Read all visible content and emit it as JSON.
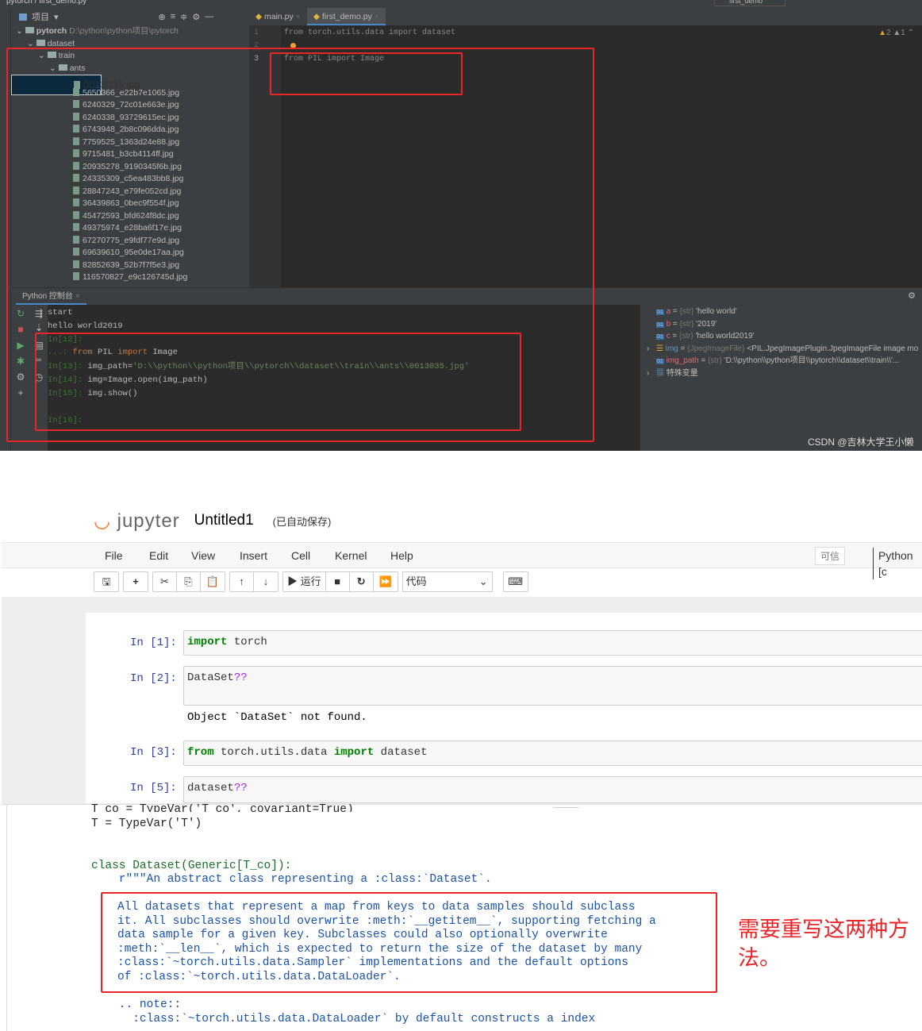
{
  "ide": {
    "breadcrumb": "pytorch  /  first_demo.py",
    "project_label": "项目",
    "project_root": {
      "name": "pytorch",
      "path": "D:\\python\\python项目\\pytorch"
    },
    "folders": [
      "dataset",
      "train",
      "ants"
    ],
    "files": [
      "0013035.jpg",
      "5650366_e22b7e1065.jpg",
      "6240329_72c01e663e.jpg",
      "6240338_93729615ec.jpg",
      "6743948_2b8c096dda.jpg",
      "7759525_1363d24e88.jpg",
      "9715481_b3cb4114ff.jpg",
      "20935278_9190345f6b.jpg",
      "24335309_c5ea483bb8.jpg",
      "28847243_e79fe052cd.jpg",
      "36439863_0bec9f554f.jpg",
      "45472593_bfd624f8dc.jpg",
      "49375974_e28ba6f17e.jpg",
      "67270775_e9fdf77e9d.jpg",
      "69639610_95e0de17aa.jpg",
      "82852639_52b7f7f5e3.jpg",
      "116570827_e9c126745d.jpg"
    ],
    "tabs": [
      "main.py",
      "first_demo.py"
    ],
    "run_config": "first_demo",
    "editor": {
      "lines": [
        {
          "n": "1",
          "text": "from torch.utils.data import dataset"
        },
        {
          "n": "2",
          "text": ""
        },
        {
          "n": "3",
          "text": "from PIL import Image"
        }
      ],
      "warnings": "2",
      "weak_warnings": "1"
    },
    "console": {
      "tab": "Python 控制台",
      "lines": [
        {
          "prompt": "",
          "text": "start"
        },
        {
          "prompt": "",
          "text": "hello world2019"
        },
        {
          "prompt": "In[12]:",
          "text": ""
        },
        {
          "prompt": "   ...:",
          "kw1": "from",
          "mid": " PIL ",
          "kw2": "import",
          "rest": " Image"
        },
        {
          "prompt": "In[13]:",
          "code": "img_path=",
          "str": "'D:\\\\python\\\\python项目\\\\pytorch\\\\dataset\\\\train\\\\ants\\\\0013035.jpg'"
        },
        {
          "prompt": "In[14]:",
          "text": "img=Image.open(img_path)"
        },
        {
          "prompt": "In[15]:",
          "text": "img.show()"
        },
        {
          "prompt": "In[16]:",
          "text": ""
        }
      ]
    },
    "variables": [
      {
        "name": "a",
        "type": "{str}",
        "value": "'hello world'"
      },
      {
        "name": "b",
        "type": "{str}",
        "value": "'2019'"
      },
      {
        "name": "c",
        "type": "{str}",
        "value": "'hello world2019'"
      },
      {
        "name": "img",
        "type": "{JpegImageFile}",
        "value": "<PIL.JpegImagePlugin.JpegImageFile image mo"
      },
      {
        "name": "img_path",
        "type": "{str}",
        "value": "'D:\\\\python\\\\python项目\\\\pytorch\\\\dataset\\\\train\\\\'..."
      },
      {
        "name": "特殊变量",
        "type": "",
        "value": ""
      }
    ],
    "watermark": "CSDN @吉林大学王小懒"
  },
  "jupyter": {
    "logo": "jupyter",
    "notebook_name": "Untitled1",
    "save_status": "(已自动保存)",
    "menu": [
      "File",
      "Edit",
      "View",
      "Insert",
      "Cell",
      "Kernel",
      "Help"
    ],
    "trusted": "可信",
    "kernel": "Python [c",
    "run_label": "运行",
    "cell_type": "代码",
    "cells": [
      {
        "prompt": "In  [1]:",
        "kw": "import",
        "rest": " torch"
      },
      {
        "prompt": "In  [2]:",
        "code": "DataSet",
        "q": "??",
        "output": "Object `DataSet` not found."
      },
      {
        "prompt": "In  [3]:",
        "kw": "from",
        "mid": " torch.utils.data ",
        "kw2": "import",
        "rest": " dataset"
      },
      {
        "prompt": "In  [5]:",
        "code": "dataset",
        "q": "??"
      }
    ],
    "pager": {
      "cut": "T_co = TypeVar('T_co', covariant=True)",
      "typevar": "T = TypeVar('T')",
      "class_line": "class Dataset(Generic[T_co]):",
      "doc_first": "    r\"\"\"An abstract class representing a :class:`Dataset`.",
      "highlight": [
        "All datasets that represent a map from keys to data samples should subclass",
        "it. All subclasses should overwrite :meth:`__getitem__`, supporting fetching a",
        "data sample for a given key. Subclasses could also optionally overwrite",
        ":meth:`__len__`, which is expected to return the size of the dataset by many",
        ":class:`~torch.utils.data.Sampler` implementations and the default options",
        "of :class:`~torch.utils.data.DataLoader`."
      ],
      "note": "    .. note::",
      "note2": "      :class:`~torch.utils.data.DataLoader` by default constructs a index"
    },
    "annotation": "需要重写这两种方法。"
  },
  "colors": {
    "highlight_box": "#e8262a",
    "ide_bg": "#2b2b2b",
    "keyword": "#cc7832"
  }
}
